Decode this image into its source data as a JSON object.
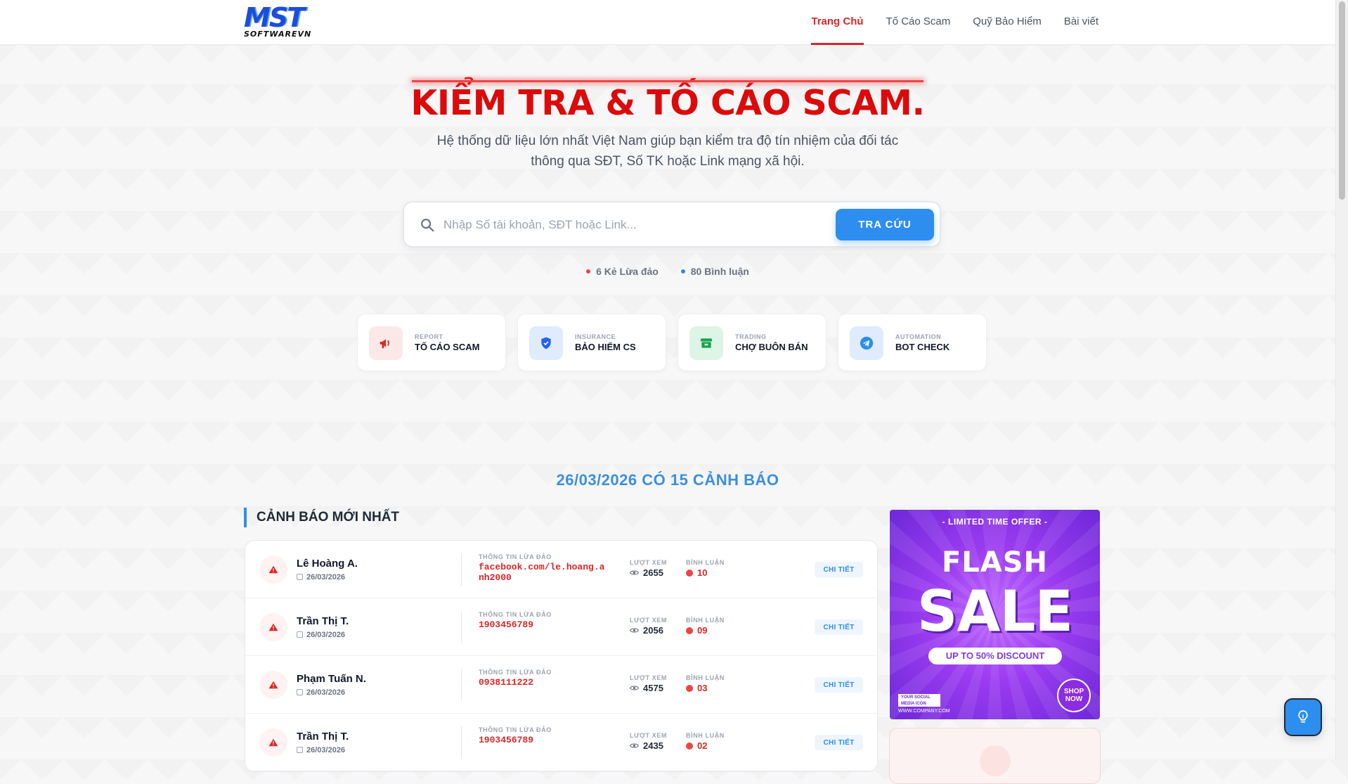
{
  "brand": {
    "mark": "MST",
    "word": "SOFTWAREVN"
  },
  "nav": [
    {
      "label": "Trang Chủ",
      "active": true
    },
    {
      "label": "Tố Cáo Scam",
      "active": false
    },
    {
      "label": "Quỹ Bảo Hiểm",
      "active": false
    },
    {
      "label": "Bài viết",
      "active": false
    }
  ],
  "hero": {
    "title": "KIỂM TRA & TỐ CÁO SCAM.",
    "subtitle": "Hệ thống dữ liệu lớn nhất Việt Nam giúp bạn kiểm tra độ tín nhiệm của đối tác thông qua SĐT, Số TK hoặc Link mạng xã hội."
  },
  "search": {
    "placeholder": "Nhập Số tài khoản, SĐT hoặc Link...",
    "button": "TRA CỨU"
  },
  "stats": [
    {
      "text": "6 Kẻ Lừa đảo",
      "color": "#ef4444"
    },
    {
      "text": "80 Bình luận",
      "color": "#3b82f6"
    }
  ],
  "features": [
    {
      "small": "REPORT",
      "big": "TỐ CÁO SCAM",
      "icon": "megaphone-icon",
      "bg": "#fde8e8",
      "color": "#dc2626"
    },
    {
      "small": "INSURANCE",
      "big": "BẢO HIỂM CS",
      "icon": "shield-icon",
      "bg": "#e0ecfd",
      "color": "#2563eb"
    },
    {
      "small": "TRADING",
      "big": "CHỢ BUÔN BÁN",
      "icon": "store-icon",
      "bg": "#dcf5e6",
      "color": "#16a34a"
    },
    {
      "small": "AUTOMATION",
      "big": "BOT CHECK",
      "icon": "telegram-icon",
      "bg": "#e0ecfd",
      "color": "#2563eb"
    }
  ],
  "date_banner": "26/03/2026 CÓ 15 CẢNH BÁO",
  "section_title": "CẢNH BÁO MỚI NHẤT",
  "labels": {
    "info": "THÔNG TIN LỪA ĐẢO",
    "views": "LƯỢT XEM",
    "comments": "BÌNH LUẬN",
    "detail": "CHI TIẾT"
  },
  "warnings": [
    {
      "name": "Lê Hoàng A.",
      "date": "26/03/2026",
      "info": "facebook.com/le.hoang.anh2000",
      "views": "2655",
      "comments": "10"
    },
    {
      "name": "Trần Thị T.",
      "date": "26/03/2026",
      "info": "1903456789",
      "views": "2056",
      "comments": "09"
    },
    {
      "name": "Phạm Tuấn N.",
      "date": "26/03/2026",
      "info": "0938111222",
      "views": "4575",
      "comments": "03"
    },
    {
      "name": "Trần Thị T.",
      "date": "26/03/2026",
      "info": "1903456789",
      "views": "2435",
      "comments": "02"
    }
  ],
  "ad": {
    "limited": "- LIMITED TIME OFFER -",
    "flash": "FLASH",
    "sale": "SALE",
    "discount": "UP TO 50% DISCOUNT",
    "social": "YOUR SOCIAL MEDIA ICON",
    "web": "WWW.COMPANY.COM",
    "shop": "SHOP NOW"
  },
  "colors": {
    "accent": "#2d8ef0",
    "danger": "#dc2626"
  }
}
